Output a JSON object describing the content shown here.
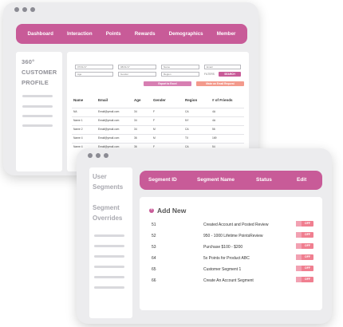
{
  "colors": {
    "primary": "#c85b98",
    "primary_light": "#d77fb2",
    "salmon": "#f39a8c",
    "toggle": "#f07f90"
  },
  "back_window": {
    "nav": [
      "Dashboard",
      "Interaction",
      "Points",
      "Rewards",
      "Demographics",
      "Member"
    ],
    "sidebar_title": [
      "360°",
      "CUSTOMER",
      "PROFILE"
    ],
    "filters": {
      "row1": [
        "07/01/17",
        "08/31/17",
        "Name",
        "Email"
      ],
      "row2": [
        "Age",
        "Gender",
        "Region"
      ],
      "filters_label": "FILTERS",
      "search_label": "SEARCH"
    },
    "buttons": {
      "export": "Export to Excel",
      "email": "Make an Email Request"
    },
    "table": {
      "headers": [
        "Name",
        "Email",
        "Age",
        "Gender",
        "Region",
        "# of Friends"
      ],
      "rows": [
        [
          "NA",
          "Email@ymail.com",
          "34",
          "F",
          "CA",
          "4A"
        ],
        [
          "Name 1",
          "Email@ymail.com",
          "34",
          "F",
          "NY",
          "4A"
        ],
        [
          "Name 2",
          "Email@ymail.com",
          "34",
          "M",
          "CA",
          "56"
        ],
        [
          "Name 4",
          "Email@ymail.com",
          "36",
          "M",
          "TX",
          "169"
        ],
        [
          "Name 4",
          "Email@ymail.com",
          "36",
          "F",
          "CA",
          "54"
        ]
      ]
    }
  },
  "front_window": {
    "sidebar": [
      "User",
      "Segments",
      "Segment",
      "Overrides"
    ],
    "headers": [
      "Segment ID",
      "Segment Name",
      "Status",
      "Edit"
    ],
    "add_new": "Add New",
    "segments": [
      {
        "id": "51",
        "name": "Created Account and Posted Review",
        "status": "OFF"
      },
      {
        "id": "52",
        "name": "950 - 1000 Lifetime PointsReview",
        "status": "OFF"
      },
      {
        "id": "53",
        "name": "Purchase $100 - $200",
        "status": "OFF"
      },
      {
        "id": "64",
        "name": "5x Points for Product ABC",
        "status": "OFF"
      },
      {
        "id": "65",
        "name": "Customer Segment 1",
        "status": "OFF"
      },
      {
        "id": "66",
        "name": "Create An Account Segment",
        "status": "OFF"
      }
    ]
  }
}
